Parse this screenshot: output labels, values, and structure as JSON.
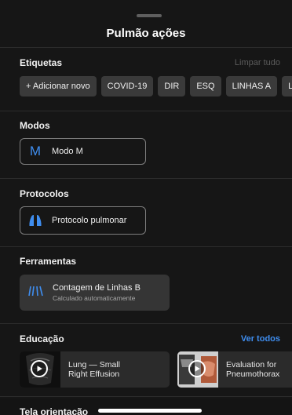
{
  "sheet": {
    "title": "Pulmão ações"
  },
  "tags": {
    "title": "Etiquetas",
    "clear_label": "Limpar tudo",
    "add_label": "+ Adicionar novo",
    "chips": [
      "COVID-19",
      "DIR",
      "ESQ",
      "LINHAS A",
      "LI"
    ]
  },
  "modes": {
    "title": "Modos",
    "button_icon": "M",
    "button_label": "Modo M"
  },
  "protocols": {
    "title": "Protocolos",
    "button_label": "Protocolo pulmonar",
    "icon": "lung-icon"
  },
  "tools": {
    "title": "Ferramentas",
    "card_icon": "b-lines-icon",
    "card_title": "Contagem de Linhas B",
    "card_subtitle": "Calculado automaticamente"
  },
  "education": {
    "title": "Educação",
    "see_all_label": "Ver todos",
    "videos": [
      {
        "title": "Lung — Small\nRight Effusion"
      },
      {
        "title": "Evaluation for\nPneumothorax"
      }
    ]
  },
  "peek": {
    "title": "Tela orientação"
  },
  "colors": {
    "accent": "#3f8ef0",
    "link": "#3f8ef0",
    "muted": "#5c5c5c",
    "chip_bg": "#3a3a3a"
  }
}
